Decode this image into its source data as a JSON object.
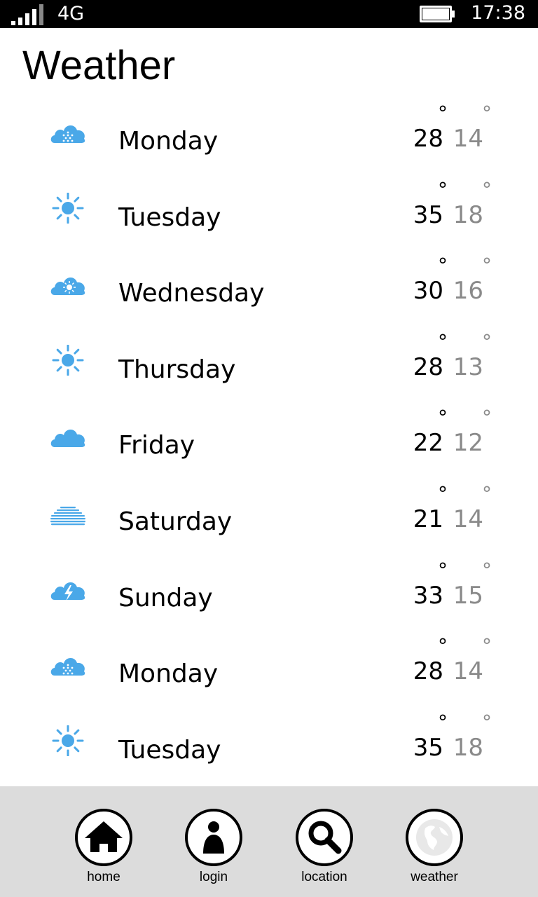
{
  "status_bar": {
    "network": "4G",
    "time": "17:38",
    "signal_bars": 5,
    "battery_icon": "battery-icon"
  },
  "header": {
    "title": "Weather"
  },
  "forecast": [
    {
      "day": "Monday",
      "high": "28",
      "low": "14",
      "icon": "rain-cloud-icon"
    },
    {
      "day": "Tuesday",
      "high": "35",
      "low": "18",
      "icon": "sun-icon"
    },
    {
      "day": "Wednesday",
      "high": "30",
      "low": "16",
      "icon": "partly-sunny-cloud-icon"
    },
    {
      "day": "Thursday",
      "high": "28",
      "low": "13",
      "icon": "sun-icon"
    },
    {
      "day": "Friday",
      "high": "22",
      "low": "12",
      "icon": "cloud-icon"
    },
    {
      "day": "Saturday",
      "high": "21",
      "low": "14",
      "icon": "fog-icon"
    },
    {
      "day": "Sunday",
      "high": "33",
      "low": "15",
      "icon": "thunderstorm-icon"
    },
    {
      "day": "Monday",
      "high": "28",
      "low": "14",
      "icon": "rain-cloud-icon"
    },
    {
      "day": "Tuesday",
      "high": "35",
      "low": "18",
      "icon": "sun-icon"
    }
  ],
  "degree_symbol": "°",
  "app_bar": {
    "items": [
      {
        "label": "home",
        "icon": "home-icon"
      },
      {
        "label": "login",
        "icon": "user-icon"
      },
      {
        "label": "location",
        "icon": "search-icon"
      },
      {
        "label": "weather",
        "icon": "globe-icon"
      }
    ]
  },
  "colors": {
    "icon_blue": "#4aa8e8",
    "low_temp_gray": "#8a8a8a",
    "app_bar_bg": "#dcdcdc",
    "status_bar_bg": "#000000"
  }
}
